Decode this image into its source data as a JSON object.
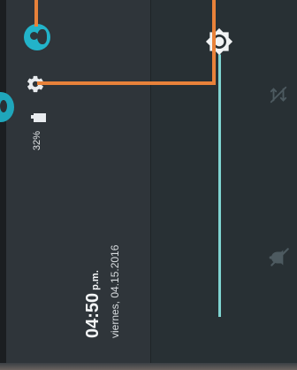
{
  "status": {
    "clock_time": "04:50",
    "clock_suffix": "p.m.",
    "date": "viernes, 04.15.2016",
    "battery_percent": "32%"
  },
  "icons": {
    "avatar": "account-circle-icon",
    "settings": "gear-icon",
    "battery": "battery-icon",
    "brightness": "brightness-icon",
    "data_disabled": "mobile-data-off-icon",
    "notifications_off": "notifications-off-icon"
  },
  "brightness": {
    "level": 0.0
  },
  "colors": {
    "accent": "#22b3c9",
    "tutorial_highlight": "#e8823a",
    "slider": "#7fd3d0"
  }
}
